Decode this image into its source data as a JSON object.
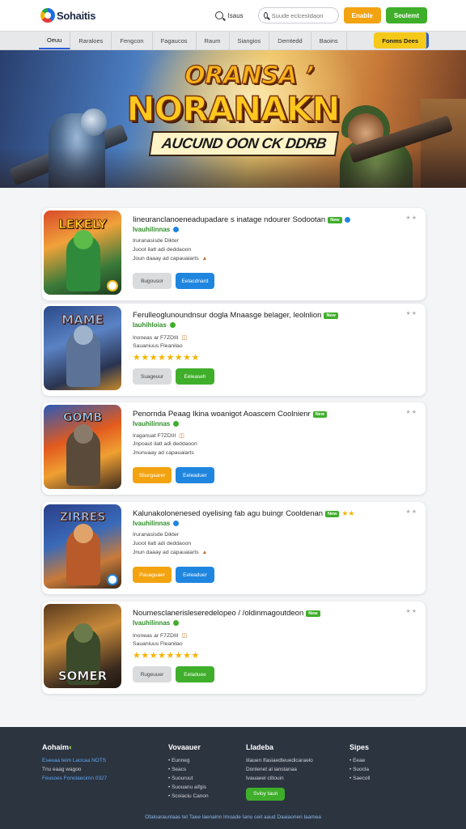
{
  "header": {
    "logo_text": "Sohaitis",
    "search_label": "Isaus",
    "search_placeholder": "Suude eclcestdaon",
    "btn_orange": "Enable",
    "btn_green": "Seulemt"
  },
  "nav": {
    "items": [
      "Oeuu",
      "Raraloes",
      "Fengcon",
      "Fagaucos",
      "Raum",
      "Siangios",
      "Demtedd",
      "Baoins"
    ],
    "cta": "Fonms Dees"
  },
  "banner": {
    "title_1": "ORANSA ’",
    "title_2": "NORANAKN",
    "subtitle": "AUCUND OON CK DDRB"
  },
  "cards": [
    {
      "title": "Iineuranclanoeneadupadare s inatage ndourer Sodootan",
      "tag": "New",
      "meta": "Ivauhilinnas",
      "line1": "Iruranasisde Dikter",
      "line2": "Juoot ilatt adi deddaoon",
      "line3": "Joun daaay ad capauaiarts",
      "stars": "",
      "rating": "★★",
      "btn_secondary": "Bugousor",
      "btn_primary": "Eelacdnard",
      "thumb_label": "LEKELY"
    },
    {
      "title": "Ferulleoglunoundnsur dogla Mnaasge belager, leolnlion",
      "tag": "New",
      "meta": "Iauhihloias",
      "line1": "Inoneas ar F7ZDIII",
      "line2": "Sauaniuus Fleanilao",
      "line3": "",
      "stars": "★★★★★★★★",
      "rating": "★★",
      "btn_secondary": "Suageuur",
      "btn_primary": "Eeleaseh",
      "thumb_label": "MAME"
    },
    {
      "title": "Penornda Peaag  Ikina woanigot Aoascem Coolnienr",
      "tag": "New",
      "meta": "Ivauhilinnas",
      "line1": "Iraganuat F7ZDIII",
      "line2": "Jnpoaut ilatt adi deddaoon",
      "line3": "Jnunuaay ad capauaiarts",
      "stars": "",
      "rating": "★★",
      "btn_secondary": "Sburgaarer",
      "btn_primary": "Eeleaduer",
      "thumb_label": "GOMB"
    },
    {
      "title": "Kalunakolonenesed oyelising fab agu buingr Cooldenan",
      "tag": "New",
      "meta": "Ivauhilinnas",
      "line1": "Iruranasisde Dikter",
      "line2": "Juoot ilatt adi deddaoon",
      "line3": "Jnun daaay ad capauaiarts",
      "stars": "",
      "rating": "★★",
      "btn_secondary": "Pauaguaer",
      "btn_primary": "Eeleaduer",
      "thumb_label": "ZIRRES"
    },
    {
      "title": "Noumesclanerisleseredelopeo / /oldinmagoutdeon",
      "tag": "New",
      "meta": "Ivauhilinnas",
      "line1": "Inoneas ar F7ZDIII",
      "line2": "Sauaniuus Fleanilao",
      "line3": "",
      "stars": "★★★★★★★★",
      "rating": "★★",
      "btn_secondary": "Rugeuuer",
      "btn_primary": "Eeladuee",
      "thumb_label": "SOMER"
    }
  ],
  "footer": {
    "col1_title": "Aohaim",
    "col1_lines": [
      "Eseeaa teim Laocaa NOTS",
      "Tnu eaag wagoo",
      "Feusoes Fonolaecimn 0327"
    ],
    "col2_title": "Vovaauer",
    "col2_lines": [
      "• Eunneg",
      "• Seacs",
      "• Suouruut",
      "• Suouanu aifgis",
      "• Scoiaciu Canon"
    ],
    "col3_title": "Lladeba",
    "col3_lines": [
      "Iilauen Ifasiaedteuedicaraelo",
      "Donlenet al ianstanaa",
      "Ivauaeel clitouin"
    ],
    "col3_button": "Svioy taun",
    "col4_title": "Sipes",
    "col4_lines": [
      "• Eeae",
      "• Suocla",
      "• Saecoll"
    ],
    "bottom": "Ofaloaraunlaas tet Taee laenainn lrnoade Ianu ceit aaud Daaiaonen laamea"
  },
  "colors": {
    "accent_blue": "#1f86e0",
    "accent_green": "#3fae2a",
    "accent_orange": "#f2a30f",
    "footer_bg": "#2c3440"
  }
}
